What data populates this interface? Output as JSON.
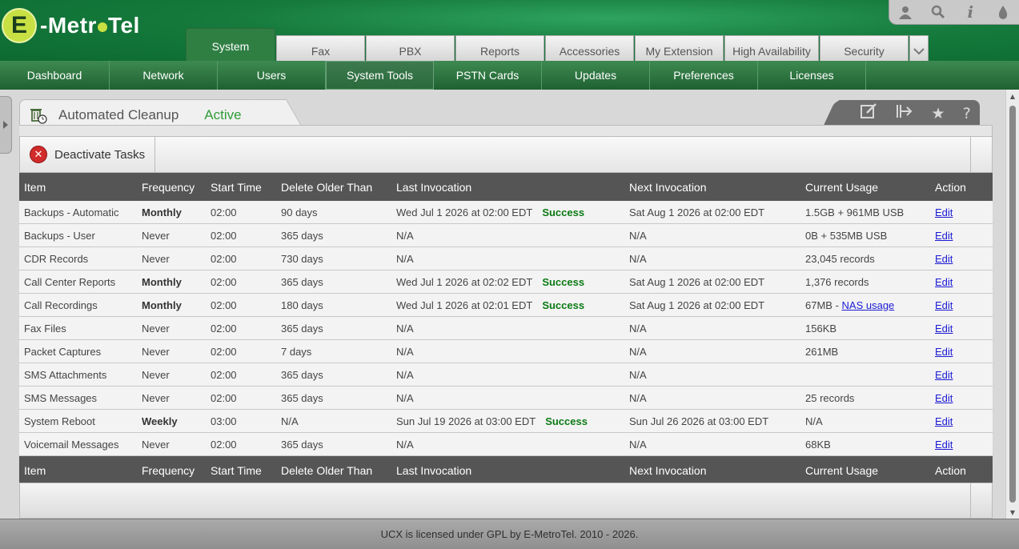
{
  "brand": {
    "logo_letter": "E",
    "logo_text_1": "-Metr",
    "logo_text_2": "Tel"
  },
  "top_tools": {
    "user": "user-icon",
    "search": "search-icon",
    "info": "info-icon",
    "theme": "drop-icon"
  },
  "main_tabs": [
    "System",
    "Fax",
    "PBX",
    "Reports",
    "Accessories",
    "My Extension",
    "High Availability",
    "Security"
  ],
  "sub_nav": [
    "Dashboard",
    "Network",
    "Users",
    "System Tools",
    "PSTN Cards",
    "Updates",
    "Preferences",
    "Licenses"
  ],
  "page": {
    "title": "Automated Cleanup",
    "status": "Active"
  },
  "toolbar": {
    "deactivate_label": "Deactivate Tasks"
  },
  "table": {
    "headers": [
      "Item",
      "Frequency",
      "Start Time",
      "Delete Older Than",
      "Last Invocation",
      "Next Invocation",
      "Current Usage",
      "Action"
    ],
    "rows": [
      {
        "item": "Backups - Automatic",
        "frequency": "Monthly",
        "freq_bold": true,
        "start": "02:00",
        "older": "90 days",
        "last": "Wed Jul 1 2026 at 02:00 EDT",
        "last_status": "Success",
        "next": "Sat Aug 1 2026 at 02:00 EDT",
        "usage": "1.5GB + 961MB USB",
        "usage_link": "",
        "action": "Edit"
      },
      {
        "item": "Backups - User",
        "frequency": "Never",
        "freq_bold": false,
        "start": "02:00",
        "older": "365 days",
        "last": "N/A",
        "last_status": "",
        "next": "N/A",
        "usage": "0B + 535MB USB",
        "usage_link": "",
        "action": "Edit"
      },
      {
        "item": "CDR Records",
        "frequency": "Never",
        "freq_bold": false,
        "start": "02:00",
        "older": "730 days",
        "last": "N/A",
        "last_status": "",
        "next": "N/A",
        "usage": "23,045 records",
        "usage_link": "",
        "action": "Edit"
      },
      {
        "item": "Call Center Reports",
        "frequency": "Monthly",
        "freq_bold": true,
        "start": "02:00",
        "older": "365 days",
        "last": "Wed Jul 1 2026 at 02:02 EDT",
        "last_status": "Success",
        "next": "Sat Aug 1 2026 at 02:00 EDT",
        "usage": "1,376 records",
        "usage_link": "",
        "action": "Edit"
      },
      {
        "item": "Call Recordings",
        "frequency": "Monthly",
        "freq_bold": true,
        "start": "02:00",
        "older": "180 days",
        "last": "Wed Jul 1 2026 at 02:01 EDT",
        "last_status": "Success",
        "next": "Sat Aug 1 2026 at 02:00 EDT",
        "usage": "67MB - ",
        "usage_link": "NAS usage",
        "action": "Edit"
      },
      {
        "item": "Fax Files",
        "frequency": "Never",
        "freq_bold": false,
        "start": "02:00",
        "older": "365 days",
        "last": "N/A",
        "last_status": "",
        "next": "N/A",
        "usage": "156KB",
        "usage_link": "",
        "action": "Edit"
      },
      {
        "item": "Packet Captures",
        "frequency": "Never",
        "freq_bold": false,
        "start": "02:00",
        "older": "7 days",
        "last": "N/A",
        "last_status": "",
        "next": "N/A",
        "usage": "261MB",
        "usage_link": "",
        "action": "Edit"
      },
      {
        "item": "SMS Attachments",
        "frequency": "Never",
        "freq_bold": false,
        "start": "02:00",
        "older": "365 days",
        "last": "N/A",
        "last_status": "",
        "next": "N/A",
        "usage": "",
        "usage_link": "",
        "action": "Edit"
      },
      {
        "item": "SMS Messages",
        "frequency": "Never",
        "freq_bold": false,
        "start": "02:00",
        "older": "365 days",
        "last": "N/A",
        "last_status": "",
        "next": "N/A",
        "usage": "25 records",
        "usage_link": "",
        "action": "Edit"
      },
      {
        "item": "System Reboot",
        "frequency": "Weekly",
        "freq_bold": true,
        "start": "03:00",
        "older": "N/A",
        "last": "Sun Jul 19 2026 at 03:00 EDT",
        "last_status": "Success",
        "next": "Sun Jul 26 2026 at 03:00 EDT",
        "usage": "N/A",
        "usage_link": "",
        "action": "Edit"
      },
      {
        "item": "Voicemail Messages",
        "frequency": "Never",
        "freq_bold": false,
        "start": "02:00",
        "older": "365 days",
        "last": "N/A",
        "last_status": "",
        "next": "N/A",
        "usage": "68KB",
        "usage_link": "",
        "action": "Edit"
      }
    ]
  },
  "footer": {
    "text": "UCX is licensed under GPL by E-MetroTel. 2010 - 2026."
  },
  "colors": {
    "brand_green": "#157a3c",
    "status_active": "#2e9d37",
    "success": "#0c7a14",
    "link": "#1a1ad6"
  }
}
